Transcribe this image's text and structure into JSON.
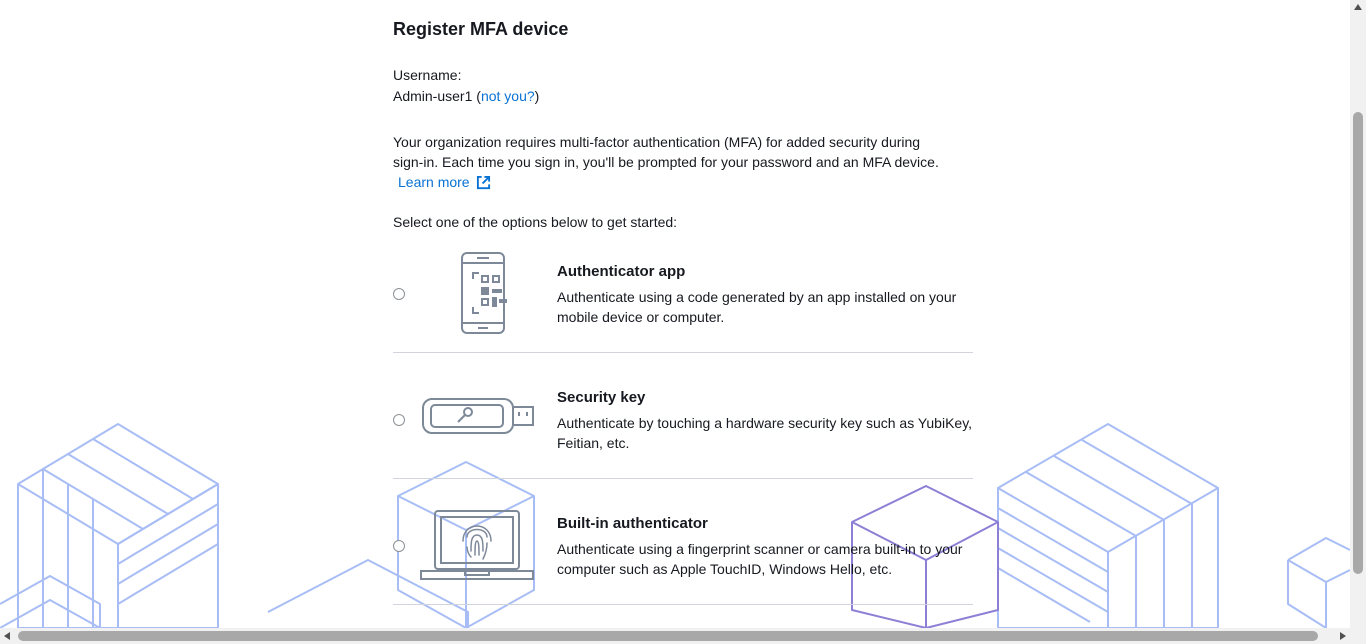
{
  "page": {
    "title": "Register MFA device"
  },
  "user": {
    "username_label": "Username:",
    "username_value": "Admin-user1",
    "open_paren": " (",
    "not_you_link": "not you?",
    "close_paren": ")"
  },
  "intro": {
    "line1": "Your organization requires multi-factor authentication (MFA) for added security during",
    "line2": "sign-in. Each time you sign in, you'll be prompted for your password and an MFA device.",
    "learn_more": "Learn more",
    "learn_more_icon": "external-link-icon",
    "select_prompt": "Select one of the options below to get started:"
  },
  "options": [
    {
      "id": "authenticator-app",
      "title": "Authenticator app",
      "description": "Authenticate using a code generated by an app installed on your mobile device or computer.",
      "icon": "mobile-qr-code-icon",
      "selected": false
    },
    {
      "id": "security-key",
      "title": "Security key",
      "description": "Authenticate by touching a hardware security key such as YubiKey, Feitian, etc.",
      "icon": "usb-security-key-icon",
      "selected": false
    },
    {
      "id": "built-in-authenticator",
      "title": "Built-in authenticator",
      "description": "Authenticate using a fingerprint scanner or camera built-in to your computer such as Apple TouchID, Windows Hello, etc.",
      "icon": "laptop-fingerprint-icon",
      "selected": false
    }
  ],
  "colors": {
    "link": "#0972d3",
    "text": "#16191f",
    "background_cube": "#a8bdf5",
    "background_cube_accent": "#8e7fd6",
    "divider": "#d1d5db"
  }
}
